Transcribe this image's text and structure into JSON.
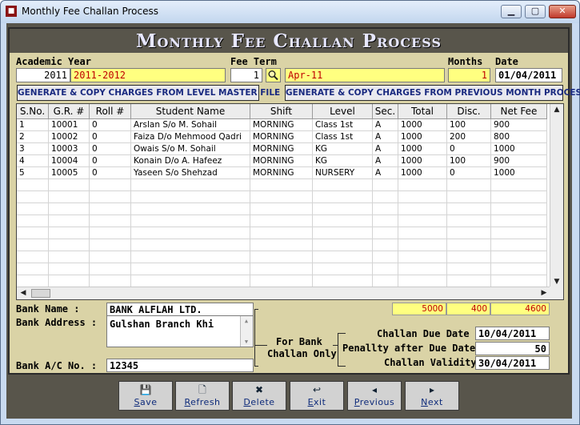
{
  "window": {
    "title": "Monthly Fee Challan Process",
    "app_icon": "app-icon",
    "controls": {
      "minimize": "▁",
      "maximize": "▢",
      "close": "✕"
    }
  },
  "banner": {
    "title": "Monthly Fee Challan Process"
  },
  "form": {
    "academic_year": {
      "label": "Academic Year",
      "code": "2011",
      "name": "2011-2012"
    },
    "fee_term": {
      "label": "Fee Term",
      "code": "1",
      "name": "Apr-11"
    },
    "months": {
      "label": "Months",
      "value": "1"
    },
    "date": {
      "label": "Date",
      "value": "01/04/2011"
    }
  },
  "buttons": {
    "generate_level": "GENERATE & COPY CHARGES FROM LEVEL MASTER FILE",
    "generate_previous": "GENERATE & COPY CHARGES FROM PREVIOUS MONTH PROCESS"
  },
  "table": {
    "columns": [
      "S.No.",
      "G.R. #",
      "Roll #",
      "Student Name",
      "Shift",
      "Level",
      "Sec.",
      "Total",
      "Disc.",
      "Net Fee"
    ],
    "rows": [
      [
        "1",
        "10001",
        "0",
        "Arslan S/o M. Sohail",
        "MORNING",
        "Class 1st",
        "A",
        "1000",
        "100",
        "900"
      ],
      [
        "2",
        "10002",
        "0",
        "Faiza D/o Mehmood Qadri",
        "MORNING",
        "Class 1st",
        "A",
        "1000",
        "200",
        "800"
      ],
      [
        "3",
        "10003",
        "0",
        "Owais S/o M. Sohail",
        "MORNING",
        "KG",
        "A",
        "1000",
        "0",
        "1000"
      ],
      [
        "4",
        "10004",
        "0",
        "Konain D/o A. Hafeez",
        "MORNING",
        "KG",
        "A",
        "1000",
        "100",
        "900"
      ],
      [
        "5",
        "10005",
        "0",
        "Yaseen S/o Shehzad",
        "MORNING",
        "NURSERY",
        "A",
        "1000",
        "0",
        "1000"
      ]
    ]
  },
  "totals": {
    "total": "5000",
    "disc": "400",
    "net": "4600"
  },
  "bank": {
    "name_label": "Bank Name :",
    "name": "BANK ALFLAH LTD.",
    "address_label": "Bank Address :",
    "address": "Gulshan Branch Khi",
    "account_label": "Bank A/C No. :",
    "account": "12345",
    "for_bank_line1": "For Bank",
    "for_bank_line2": "Challan Only"
  },
  "challan": {
    "due_date_label": "Challan Due Date :",
    "due_date": "10/04/2011",
    "penalty_label": "Penallty after Due Date :",
    "penalty": "50",
    "validity_label": "Challan Validity :",
    "validity": "30/04/2011"
  },
  "toolbar": [
    {
      "label": "Save",
      "icon": "save-icon"
    },
    {
      "label": "Refresh",
      "icon": "page-icon"
    },
    {
      "label": "Delete",
      "icon": "delete-icon"
    },
    {
      "label": "Exit",
      "icon": "exit-icon"
    },
    {
      "label": "Previous",
      "icon": "left-arrow-icon"
    },
    {
      "label": "Next",
      "icon": "right-arrow-icon"
    }
  ],
  "colors": {
    "frame": "#dad3a6",
    "dark": "#58554b",
    "highlight": "#ffff80",
    "highlight_text": "#c00000",
    "button_text": "#1a2a80"
  }
}
